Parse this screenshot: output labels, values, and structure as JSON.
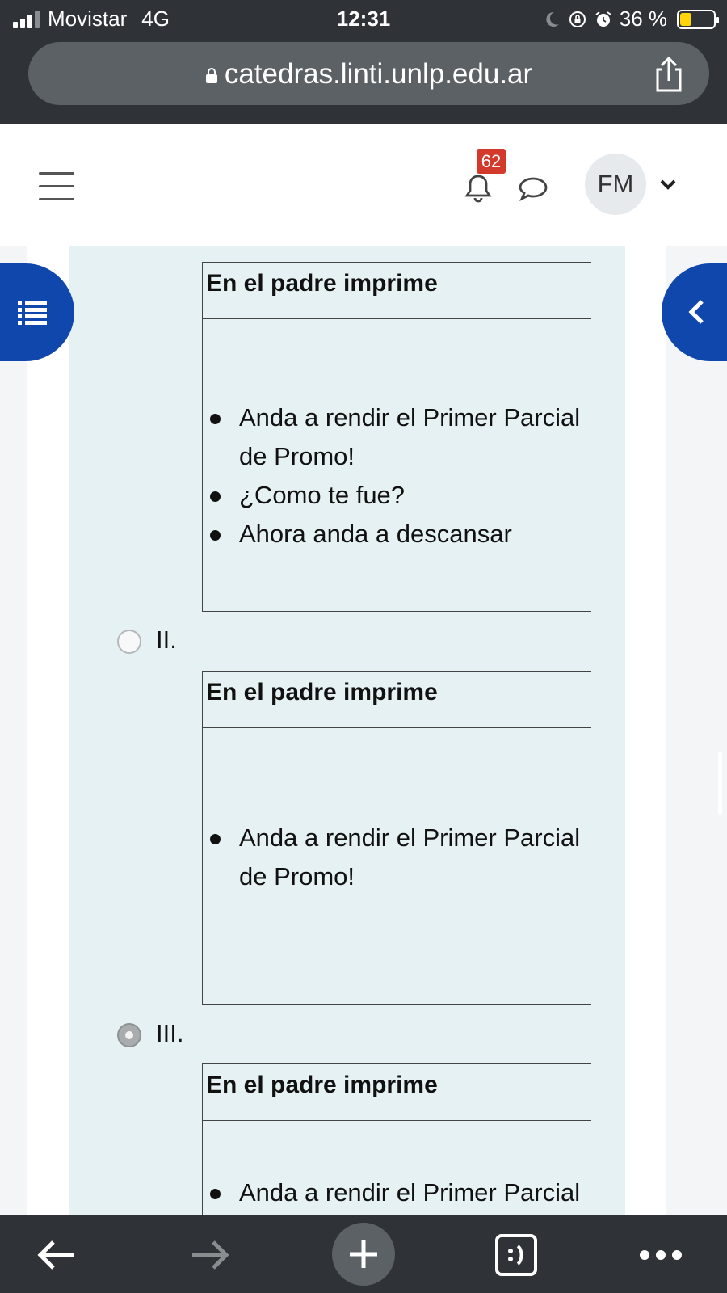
{
  "status_bar": {
    "carrier": "Movistar",
    "network": "4G",
    "time": "12:31",
    "battery_text": "36 %",
    "battery_level": 0.36,
    "icons": [
      "signal-icon",
      "moon-icon",
      "orientation-lock-icon",
      "alarm-icon",
      "battery-icon"
    ]
  },
  "browser": {
    "url": "catedras.linti.unlp.edu.ar",
    "icons": [
      "lock-icon",
      "share-icon"
    ]
  },
  "header": {
    "notification_count": "62",
    "avatar_initials": "FM",
    "icons": [
      "hamburger-menu-icon",
      "bell-icon",
      "chat-icon",
      "chevron-down-icon"
    ]
  },
  "question": {
    "blocks": [
      {
        "title": "En el padre imprime",
        "items": [
          "Anda a rendir el Primer Parcial de Promo!",
          "¿Como te fue?",
          "Ahora anda a descansar"
        ]
      },
      {
        "label": "II.",
        "selected": false,
        "title": "En el padre imprime",
        "items": [
          "Anda a rendir el Primer Parcial de Promo!"
        ]
      },
      {
        "label": "III.",
        "selected": true,
        "title": "En el padre imprime",
        "items": [
          "Anda a rendir el Primer Parcial"
        ]
      }
    ]
  },
  "side_tabs": {
    "left_icon": "list-icon",
    "right_icon": "chevron-left-icon",
    "color": "#0f47ad"
  },
  "toolbar": {
    "icons": [
      "back-arrow-icon",
      "forward-arrow-icon",
      "plus-icon",
      "tabs-icon",
      "more-icon"
    ]
  }
}
